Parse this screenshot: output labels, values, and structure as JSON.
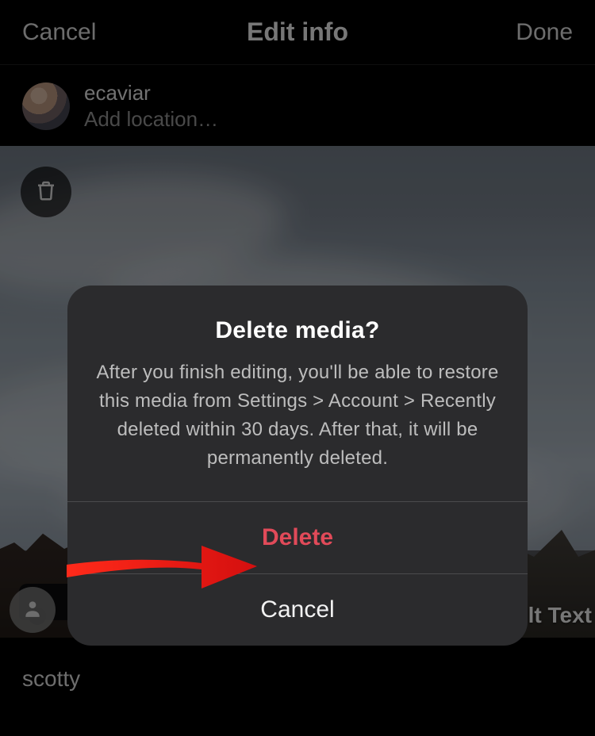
{
  "colors": {
    "destructive": "#e14a59"
  },
  "topbar": {
    "cancel": "Cancel",
    "title": "Edit info",
    "done": "Done"
  },
  "user": {
    "name": "ecaviar"
  },
  "location": {
    "placeholder": "Add location…"
  },
  "photo": {
    "alt_text_label": "lt Text",
    "icons": {
      "trash": "trash-icon",
      "tag": "person-tag-icon"
    }
  },
  "caption": {
    "text": "scotty"
  },
  "alert": {
    "title": "Delete media?",
    "message": "After you finish editing, you'll be able to restore this media from Settings > Account > Recently deleted within 30 days. After that, it will be permanently deleted.",
    "delete": "Delete",
    "cancel": "Cancel"
  }
}
